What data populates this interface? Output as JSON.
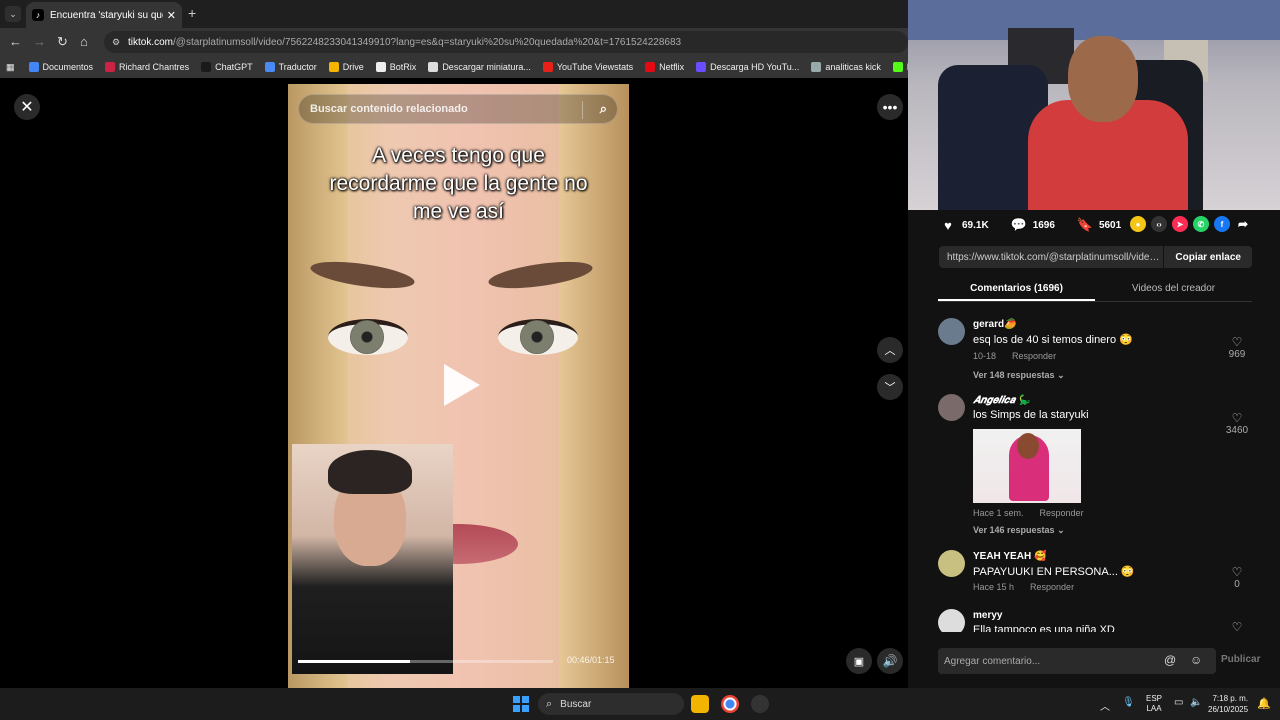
{
  "browser": {
    "tab_title": "Encuentra 'staryuki su quedada'",
    "url_host": "tiktok.com",
    "url_path": "/@starplatinumsoll/video/7562248233041349910?lang=es&q=staryuki%20su%20quedada%20&t=1761524228683",
    "bookmarks": [
      "Documentos",
      "Richard Chantres",
      "ChatGPT",
      "Traductor",
      "Drive",
      "BotRix",
      "Descargar miniatura...",
      "YouTube Viewstats",
      "Netflix",
      "Descarga HD YouTu...",
      "analiticas kick",
      "kick descarga"
    ],
    "bookmark_colors": [
      "#4285f4",
      "#cc2244",
      "#1a1a1a",
      "#4a8af4",
      "#f4b400",
      "#eee",
      "#dddddd",
      "#e62117",
      "#e50914",
      "#6b4cff",
      "#9aa",
      "#53fc18"
    ]
  },
  "video": {
    "search_placeholder": "Buscar contenido relacionado",
    "caption": "A veces tengo que\nrecordarme que la gente no\nme ve así",
    "time": "00:46/01:15",
    "progress": 0.44
  },
  "stats": {
    "likes": "69.1K",
    "comments": "1696",
    "saves": "5601"
  },
  "link": {
    "url": "https://www.tiktok.com/@starplatinumsoll/video/...",
    "copy_label": "Copiar enlace"
  },
  "tabs": {
    "comments": "Comentarios (1696)",
    "creator_videos": "Videos del creador"
  },
  "comments": [
    {
      "name": "gerard🥭",
      "text": "esq los de 40 si temos dinero 😳",
      "date": "10-18",
      "reply": "Responder",
      "replies": "Ver 148 respuestas",
      "likes": "969"
    },
    {
      "name": "𝑨𝒏𝒈𝒆𝒍𝒊𝒄𝒂 🦕",
      "text": "los Simps de la staryuki",
      "date": "Hace 1 sem.",
      "reply": "Responder",
      "replies": "Ver 146 respuestas",
      "likes": "3460"
    },
    {
      "name": "YEAH YEAH 🥰",
      "text": "PAPAYUUKI EN PERSONA... 😳",
      "date": "Hace 15 h",
      "reply": "Responder",
      "likes": "0"
    },
    {
      "name": "meryy",
      "text": "Ella tampoco es una niña XD"
    }
  ],
  "comment_input": {
    "placeholder": "Agregar comentario...",
    "publish": "Publicar"
  },
  "taskbar": {
    "search": "Buscar",
    "lang": "ESP",
    "layout": "LAA",
    "time": "7:18 p. m.",
    "date": "26/10/2025"
  }
}
